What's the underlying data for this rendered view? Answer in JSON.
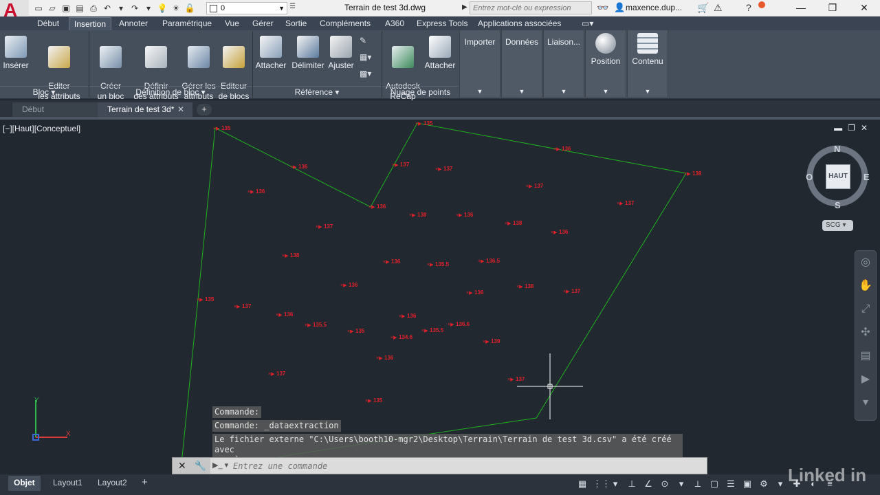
{
  "titlebar": {
    "doc_title": "Terrain de test 3d.dwg",
    "layer_value": "0",
    "search_placeholder": "Entrez mot-clé ou expression",
    "user": "maxence.dup..."
  },
  "ribbon_tabs": [
    "Début",
    "Insertion",
    "Annoter",
    "Paramétrique",
    "Vue",
    "Gérer",
    "Sortie",
    "Compléments",
    "A360",
    "Express Tools",
    "Applications associées"
  ],
  "ribbon_active_tab": "Insertion",
  "ribbon": {
    "bloc": {
      "title": "Bloc",
      "inserer": "Insérer",
      "editer": "Editer\nles attributs"
    },
    "definition": {
      "title": "Définition de bloc",
      "creer": "Créer\nun bloc",
      "definir": "Définir\ndes attributs",
      "gerer": "Gérer les\nattributs",
      "editeur": "Editeur\nde blocs"
    },
    "reference": {
      "title": "Référence",
      "attacher": "Attacher",
      "delimiter": "Délimiter",
      "ajuster": "Ajuster"
    },
    "nuage": {
      "title": "Nuage de points",
      "recap": "Autodesk\nReCap",
      "attacher": "Attacher"
    },
    "flyouts": {
      "importer": "Importer",
      "donnees": "Données",
      "liaison": "Liaison..."
    },
    "position": "Position",
    "contenu": "Contenu"
  },
  "file_tabs": {
    "debut": "Début",
    "active": "Terrain de test 3d*"
  },
  "viewport": {
    "label": "[−][Haut][Conceptuel]",
    "viewcube": {
      "n": "N",
      "s": "S",
      "e": "E",
      "o": "O",
      "face": "HAUT",
      "ucs": "SCG"
    }
  },
  "drawing": {
    "boundary_color": "#1fb31f",
    "point_color": "#e0202a",
    "points": [
      {
        "label": "135"
      },
      {
        "label": "136"
      },
      {
        "label": "136"
      },
      {
        "label": "135"
      },
      {
        "label": "136"
      },
      {
        "label": "138"
      },
      {
        "label": "137"
      },
      {
        "label": "137"
      },
      {
        "label": "136"
      },
      {
        "label": "137"
      },
      {
        "label": "137"
      },
      {
        "label": "138"
      },
      {
        "label": "136"
      },
      {
        "label": "138"
      },
      {
        "label": "136"
      },
      {
        "label": "137"
      },
      {
        "label": "138"
      },
      {
        "label": "136.5"
      },
      {
        "label": "136"
      },
      {
        "label": "135.5"
      },
      {
        "label": "138"
      },
      {
        "label": "137"
      },
      {
        "label": "136"
      },
      {
        "label": "135"
      },
      {
        "label": "137"
      },
      {
        "label": "136"
      },
      {
        "label": "135.5"
      },
      {
        "label": "135"
      },
      {
        "label": "136"
      },
      {
        "label": "134.6"
      },
      {
        "label": "135.5"
      },
      {
        "label": "136.6"
      },
      {
        "label": "136"
      },
      {
        "label": "139"
      },
      {
        "label": "136"
      },
      {
        "label": "137"
      },
      {
        "label": "137"
      },
      {
        "label": "135"
      }
    ]
  },
  "command": {
    "history": [
      "Commande:",
      "Commande: _dataextraction",
      "Le fichier externe \"C:\\Users\\booth10-mgr2\\Desktop\\Terrain\\Terrain de test 3d.csv\" a été créé avec\nsuccès."
    ],
    "placeholder": "Entrez une commande"
  },
  "layout_tabs": [
    "Objet",
    "Layout1",
    "Layout2"
  ],
  "watermark": "Linked in"
}
